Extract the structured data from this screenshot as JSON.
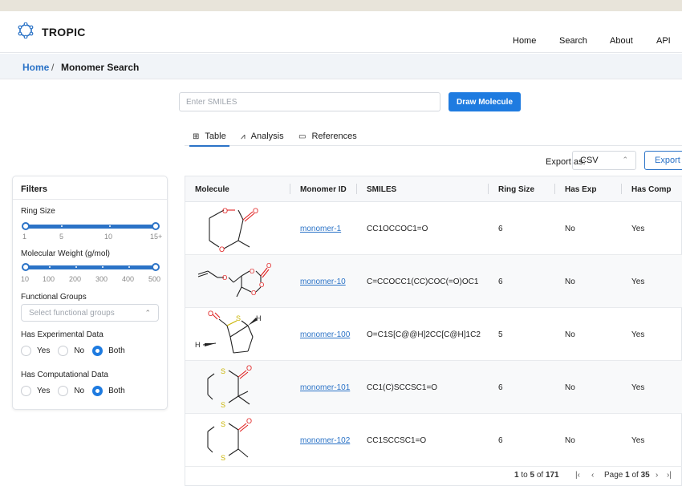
{
  "app": {
    "name": "TROPIC"
  },
  "nav": {
    "items": [
      "Home",
      "Search",
      "About",
      "API"
    ]
  },
  "breadcrumb": {
    "home": "Home",
    "separator": "/",
    "current": "Monomer Search"
  },
  "search": {
    "placeholder": "Enter SMILES",
    "value": "",
    "draw_label": "Draw Molecule"
  },
  "tabs": [
    {
      "label": "Table",
      "icon": "table-icon",
      "active": true
    },
    {
      "label": "Analysis",
      "icon": "chart-icon",
      "active": false
    },
    {
      "label": "References",
      "icon": "book-icon",
      "active": false
    }
  ],
  "export": {
    "label": "Export as:",
    "format": "CSV",
    "button": "Export"
  },
  "filters": {
    "title": "Filters",
    "ring_size": {
      "label": "Ring Size",
      "ticks": [
        "1",
        "5",
        "10",
        "15+"
      ],
      "range": [
        1,
        15
      ]
    },
    "mol_weight": {
      "label": "Molecular Weight (g/mol)",
      "ticks": [
        "10",
        "100",
        "200",
        "300",
        "400",
        "500"
      ],
      "range": [
        10,
        500
      ]
    },
    "functional_groups": {
      "label": "Functional Groups",
      "placeholder": "Select functional groups"
    },
    "has_exp": {
      "label": "Has Experimental Data",
      "options": [
        "Yes",
        "No",
        "Both"
      ],
      "selected": "Both"
    },
    "has_comp": {
      "label": "Has Computational Data",
      "options": [
        "Yes",
        "No",
        "Both"
      ],
      "selected": "Both"
    }
  },
  "table": {
    "columns": [
      "Molecule",
      "Monomer ID",
      "SMILES",
      "Ring Size",
      "Has Exp",
      "Has Comp"
    ],
    "rows": [
      {
        "id": "monomer-1",
        "smiles": "CC1OCCOC1=O",
        "ring": "6",
        "exp": "No",
        "comp": "Yes"
      },
      {
        "id": "monomer-10",
        "smiles": "C=CCOCC1(CC)COC(=O)OC1",
        "ring": "6",
        "exp": "No",
        "comp": "Yes"
      },
      {
        "id": "monomer-100",
        "smiles": "O=C1S[C@@H]2CC[C@H]1C2",
        "ring": "5",
        "exp": "No",
        "comp": "Yes"
      },
      {
        "id": "monomer-101",
        "smiles": "CC1(C)SCCSC1=O",
        "ring": "6",
        "exp": "No",
        "comp": "Yes"
      },
      {
        "id": "monomer-102",
        "smiles": "CC1SCCSC1=O",
        "ring": "6",
        "exp": "No",
        "comp": "Yes"
      }
    ]
  },
  "pagination": {
    "range_from": "1",
    "to_word": "to",
    "range_to": "5",
    "of_word": "of",
    "total": "171",
    "page_word": "Page",
    "page": "1",
    "page_of_word": "of",
    "page_count": "35"
  },
  "colors": {
    "accent": "#1e7be0",
    "link": "#2b73c7",
    "oxygen": "#e02020",
    "sulfur": "#c9b400"
  }
}
